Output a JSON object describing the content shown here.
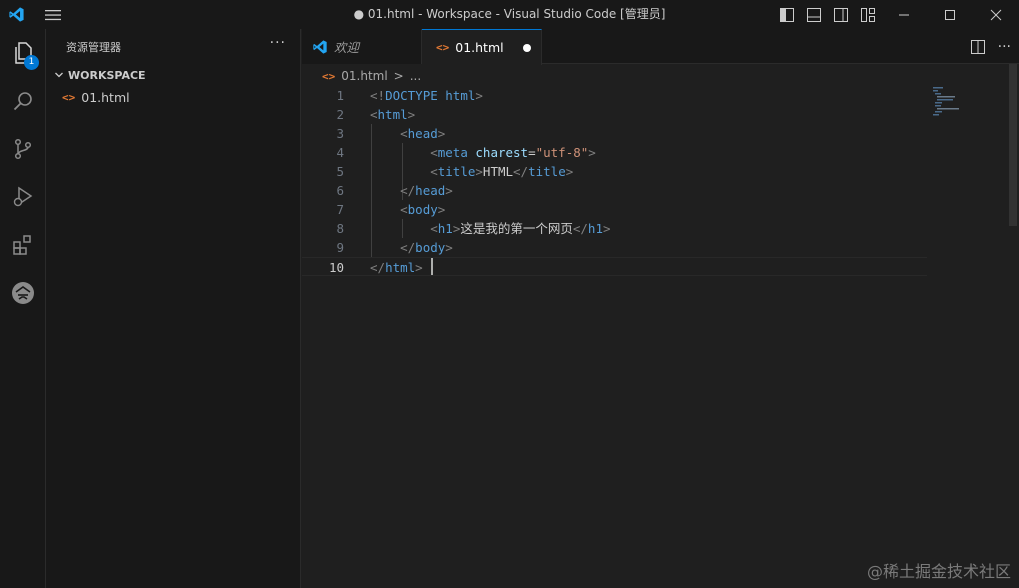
{
  "titlebar": {
    "title": "● 01.html - Workspace - Visual Studio Code [管理员]",
    "icons": [
      "vscode-logo-icon",
      "menu-icon",
      "toggle-primary-sidebar-icon",
      "toggle-panel-icon",
      "toggle-secondary-sidebar-icon",
      "customize-layout-icon",
      "minimize-icon",
      "maximize-icon",
      "close-icon"
    ]
  },
  "activity_bar": {
    "items": [
      "explorer-icon",
      "search-icon",
      "source-control-icon",
      "run-debug-icon",
      "extensions-icon",
      "remote-icon"
    ],
    "explorer_badge": "1"
  },
  "sidebar": {
    "title": "资源管理器",
    "more": "···",
    "section": "WORKSPACE",
    "files": [
      {
        "name": "01.html"
      }
    ]
  },
  "tabs": [
    {
      "label": "欢迎",
      "active": false
    },
    {
      "label": "01.html",
      "active": true,
      "dirty": true
    }
  ],
  "breadcrumb": {
    "file": "01.html",
    "sep": ">",
    "rest": "..."
  },
  "editor": {
    "active_line": 10,
    "lines": [
      {
        "n": "1",
        "text": "<!DOCTYPE html>"
      },
      {
        "n": "2",
        "text": "<html>"
      },
      {
        "n": "3",
        "text": "    <head>"
      },
      {
        "n": "4",
        "text": "        <meta charest=\"utf-8\">"
      },
      {
        "n": "5",
        "text": "        <title>HTML</title>"
      },
      {
        "n": "6",
        "text": "    </head>"
      },
      {
        "n": "7",
        "text": "    <body>"
      },
      {
        "n": "8",
        "text": "        <h1>这是我的第一个网页</h1>"
      },
      {
        "n": "9",
        "text": "    </body>"
      },
      {
        "n": "10",
        "text": "</html>"
      }
    ]
  },
  "watermark": "@稀土掘金技术社区",
  "colors": {
    "accent": "#0078d4",
    "html_icon": "#e37933",
    "tag": "#569cd6",
    "attribute": "#9cdcfe",
    "string": "#ce9178"
  }
}
